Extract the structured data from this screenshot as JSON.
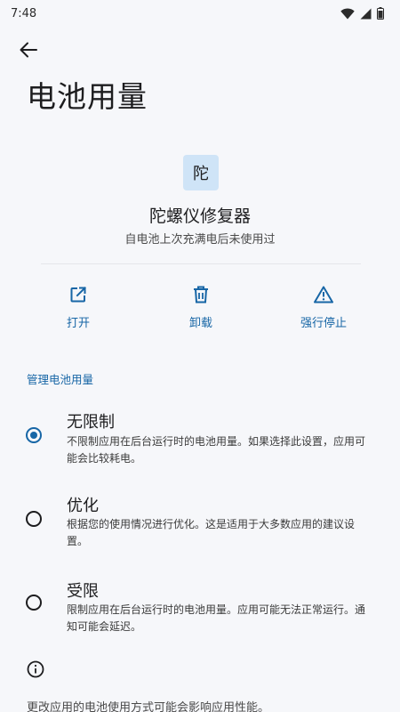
{
  "status_bar": {
    "time": "7:48"
  },
  "header": {
    "title": "电池用量"
  },
  "app": {
    "icon_char": "陀",
    "name": "陀螺仪修复器",
    "subtitle": "自电池上次充满电后未使用过"
  },
  "actions": [
    {
      "label": "打开",
      "icon": "open-external-icon"
    },
    {
      "label": "卸载",
      "icon": "trash-icon"
    },
    {
      "label": "强行停止",
      "icon": "warning-icon"
    }
  ],
  "section": {
    "label": "管理电池用量"
  },
  "options": [
    {
      "title": "无限制",
      "desc": "不限制应用在后台运行时的电池用量。如果选择此设置，应用可能会比较耗电。",
      "selected": true
    },
    {
      "title": "优化",
      "desc": "根据您的使用情况进行优化。这是适用于大多数应用的建议设置。",
      "selected": false
    },
    {
      "title": "受限",
      "desc": "限制应用在后台运行时的电池用量。应用可能无法正常运行。通知可能会延迟。",
      "selected": false
    }
  ],
  "footer": {
    "note": "更改应用的电池使用方式可能会影响应用性能。"
  },
  "colors": {
    "accent": "#1766a6",
    "icon_bg": "#cfe4f7",
    "background": "#f6f7fa"
  }
}
